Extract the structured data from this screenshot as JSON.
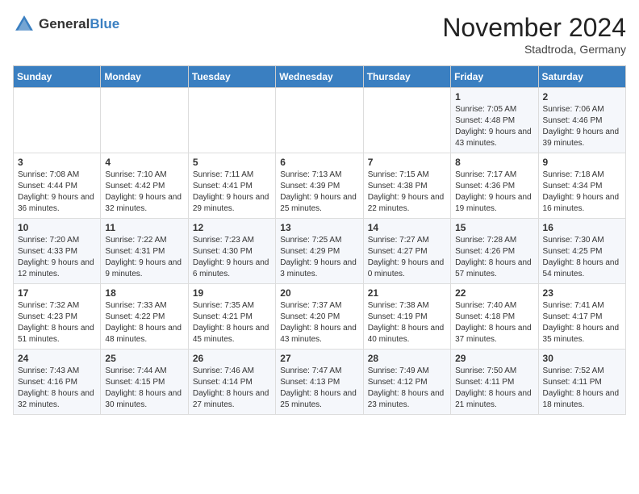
{
  "logo": {
    "general": "General",
    "blue": "Blue"
  },
  "title": "November 2024",
  "location": "Stadtroda, Germany",
  "days_of_week": [
    "Sunday",
    "Monday",
    "Tuesday",
    "Wednesday",
    "Thursday",
    "Friday",
    "Saturday"
  ],
  "weeks": [
    [
      {
        "day": "",
        "sunrise": "",
        "sunset": "",
        "daylight": ""
      },
      {
        "day": "",
        "sunrise": "",
        "sunset": "",
        "daylight": ""
      },
      {
        "day": "",
        "sunrise": "",
        "sunset": "",
        "daylight": ""
      },
      {
        "day": "",
        "sunrise": "",
        "sunset": "",
        "daylight": ""
      },
      {
        "day": "",
        "sunrise": "",
        "sunset": "",
        "daylight": ""
      },
      {
        "day": "1",
        "sunrise": "Sunrise: 7:05 AM",
        "sunset": "Sunset: 4:48 PM",
        "daylight": "Daylight: 9 hours and 43 minutes."
      },
      {
        "day": "2",
        "sunrise": "Sunrise: 7:06 AM",
        "sunset": "Sunset: 4:46 PM",
        "daylight": "Daylight: 9 hours and 39 minutes."
      }
    ],
    [
      {
        "day": "3",
        "sunrise": "Sunrise: 7:08 AM",
        "sunset": "Sunset: 4:44 PM",
        "daylight": "Daylight: 9 hours and 36 minutes."
      },
      {
        "day": "4",
        "sunrise": "Sunrise: 7:10 AM",
        "sunset": "Sunset: 4:42 PM",
        "daylight": "Daylight: 9 hours and 32 minutes."
      },
      {
        "day": "5",
        "sunrise": "Sunrise: 7:11 AM",
        "sunset": "Sunset: 4:41 PM",
        "daylight": "Daylight: 9 hours and 29 minutes."
      },
      {
        "day": "6",
        "sunrise": "Sunrise: 7:13 AM",
        "sunset": "Sunset: 4:39 PM",
        "daylight": "Daylight: 9 hours and 25 minutes."
      },
      {
        "day": "7",
        "sunrise": "Sunrise: 7:15 AM",
        "sunset": "Sunset: 4:38 PM",
        "daylight": "Daylight: 9 hours and 22 minutes."
      },
      {
        "day": "8",
        "sunrise": "Sunrise: 7:17 AM",
        "sunset": "Sunset: 4:36 PM",
        "daylight": "Daylight: 9 hours and 19 minutes."
      },
      {
        "day": "9",
        "sunrise": "Sunrise: 7:18 AM",
        "sunset": "Sunset: 4:34 PM",
        "daylight": "Daylight: 9 hours and 16 minutes."
      }
    ],
    [
      {
        "day": "10",
        "sunrise": "Sunrise: 7:20 AM",
        "sunset": "Sunset: 4:33 PM",
        "daylight": "Daylight: 9 hours and 12 minutes."
      },
      {
        "day": "11",
        "sunrise": "Sunrise: 7:22 AM",
        "sunset": "Sunset: 4:31 PM",
        "daylight": "Daylight: 9 hours and 9 minutes."
      },
      {
        "day": "12",
        "sunrise": "Sunrise: 7:23 AM",
        "sunset": "Sunset: 4:30 PM",
        "daylight": "Daylight: 9 hours and 6 minutes."
      },
      {
        "day": "13",
        "sunrise": "Sunrise: 7:25 AM",
        "sunset": "Sunset: 4:29 PM",
        "daylight": "Daylight: 9 hours and 3 minutes."
      },
      {
        "day": "14",
        "sunrise": "Sunrise: 7:27 AM",
        "sunset": "Sunset: 4:27 PM",
        "daylight": "Daylight: 9 hours and 0 minutes."
      },
      {
        "day": "15",
        "sunrise": "Sunrise: 7:28 AM",
        "sunset": "Sunset: 4:26 PM",
        "daylight": "Daylight: 8 hours and 57 minutes."
      },
      {
        "day": "16",
        "sunrise": "Sunrise: 7:30 AM",
        "sunset": "Sunset: 4:25 PM",
        "daylight": "Daylight: 8 hours and 54 minutes."
      }
    ],
    [
      {
        "day": "17",
        "sunrise": "Sunrise: 7:32 AM",
        "sunset": "Sunset: 4:23 PM",
        "daylight": "Daylight: 8 hours and 51 minutes."
      },
      {
        "day": "18",
        "sunrise": "Sunrise: 7:33 AM",
        "sunset": "Sunset: 4:22 PM",
        "daylight": "Daylight: 8 hours and 48 minutes."
      },
      {
        "day": "19",
        "sunrise": "Sunrise: 7:35 AM",
        "sunset": "Sunset: 4:21 PM",
        "daylight": "Daylight: 8 hours and 45 minutes."
      },
      {
        "day": "20",
        "sunrise": "Sunrise: 7:37 AM",
        "sunset": "Sunset: 4:20 PM",
        "daylight": "Daylight: 8 hours and 43 minutes."
      },
      {
        "day": "21",
        "sunrise": "Sunrise: 7:38 AM",
        "sunset": "Sunset: 4:19 PM",
        "daylight": "Daylight: 8 hours and 40 minutes."
      },
      {
        "day": "22",
        "sunrise": "Sunrise: 7:40 AM",
        "sunset": "Sunset: 4:18 PM",
        "daylight": "Daylight: 8 hours and 37 minutes."
      },
      {
        "day": "23",
        "sunrise": "Sunrise: 7:41 AM",
        "sunset": "Sunset: 4:17 PM",
        "daylight": "Daylight: 8 hours and 35 minutes."
      }
    ],
    [
      {
        "day": "24",
        "sunrise": "Sunrise: 7:43 AM",
        "sunset": "Sunset: 4:16 PM",
        "daylight": "Daylight: 8 hours and 32 minutes."
      },
      {
        "day": "25",
        "sunrise": "Sunrise: 7:44 AM",
        "sunset": "Sunset: 4:15 PM",
        "daylight": "Daylight: 8 hours and 30 minutes."
      },
      {
        "day": "26",
        "sunrise": "Sunrise: 7:46 AM",
        "sunset": "Sunset: 4:14 PM",
        "daylight": "Daylight: 8 hours and 27 minutes."
      },
      {
        "day": "27",
        "sunrise": "Sunrise: 7:47 AM",
        "sunset": "Sunset: 4:13 PM",
        "daylight": "Daylight: 8 hours and 25 minutes."
      },
      {
        "day": "28",
        "sunrise": "Sunrise: 7:49 AM",
        "sunset": "Sunset: 4:12 PM",
        "daylight": "Daylight: 8 hours and 23 minutes."
      },
      {
        "day": "29",
        "sunrise": "Sunrise: 7:50 AM",
        "sunset": "Sunset: 4:11 PM",
        "daylight": "Daylight: 8 hours and 21 minutes."
      },
      {
        "day": "30",
        "sunrise": "Sunrise: 7:52 AM",
        "sunset": "Sunset: 4:11 PM",
        "daylight": "Daylight: 8 hours and 18 minutes."
      }
    ]
  ]
}
